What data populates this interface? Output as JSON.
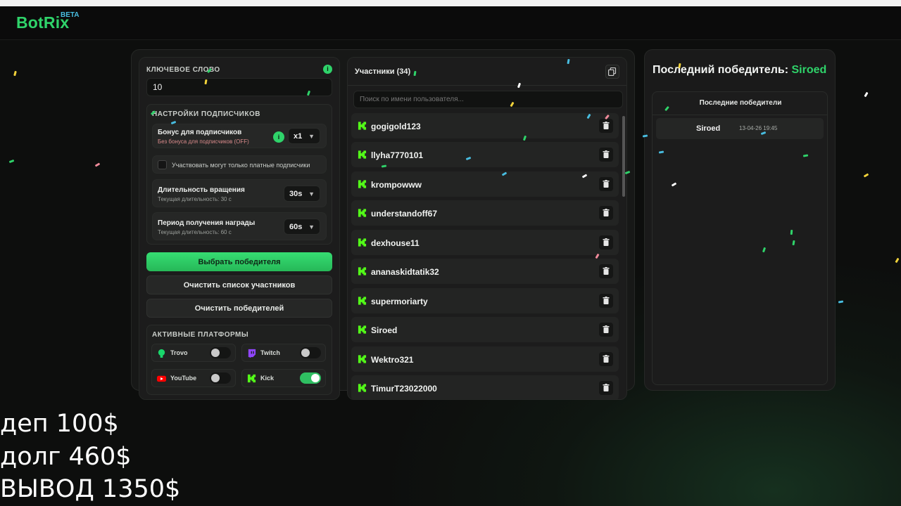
{
  "app": {
    "logo": "BotRix",
    "logo_badge": "BETA"
  },
  "keyword": {
    "label": "КЛЮЧЕВОЕ СЛОВО",
    "value": "10",
    "info_icon": "info-icon"
  },
  "subscriber_settings": {
    "title": "НАСТРОЙКИ ПОДПИСЧИКОВ",
    "bonus": {
      "title": "Бонус для подписчиков",
      "subtitle": "Без бонуса для подписчиков (OFF)",
      "select": "x1"
    },
    "only_paid": {
      "label": "Участвовать могут только платные подписчики"
    },
    "spin_duration": {
      "title": "Длительность вращения",
      "subtitle": "Текущая длительность: 30 с",
      "select": "30s"
    },
    "reward_period": {
      "title": "Период получения награды",
      "subtitle": "Текущая длительность: 60 с",
      "select": "60s"
    }
  },
  "buttons": {
    "pick_winner": "Выбрать победителя",
    "clear_participants": "Очистить список участников",
    "clear_winners": "Очистить победителей"
  },
  "platforms": {
    "title": "АКТИВНЫЕ ПЛАТФОРМЫ",
    "items": [
      {
        "label": "Trovo",
        "enabled": false,
        "color": "#19d66b"
      },
      {
        "label": "Twitch",
        "enabled": false,
        "color": "#9146ff"
      },
      {
        "label": "YouTube",
        "enabled": false,
        "color": "#ff0000"
      },
      {
        "label": "Kick",
        "enabled": true,
        "color": "#53fc18"
      }
    ]
  },
  "participants": {
    "title": "Участники (34)",
    "search_placeholder": "Поиск по имени пользователя...",
    "items": [
      "gogigold123",
      "llyha7770101",
      "krompowww",
      "understandoff67",
      "dexhouse11",
      "ananaskidtatik32",
      "supermoriarty",
      "Siroed",
      "Wektro321",
      "TimurT23022000"
    ]
  },
  "last_winner": {
    "label": "Последний победитель:",
    "name": "Siroed",
    "recent_title": "Последние победители",
    "recent": [
      {
        "name": "Siroed",
        "time": "13-04-26 19:45"
      }
    ]
  },
  "overlay": {
    "line1": "деп 100$",
    "line2": "долг 460$",
    "line3": "ВЫВОД 1350$"
  },
  "colors": {
    "accent": "#2fd36a",
    "kick": "#53fc18",
    "background": "#0d0e0d"
  }
}
